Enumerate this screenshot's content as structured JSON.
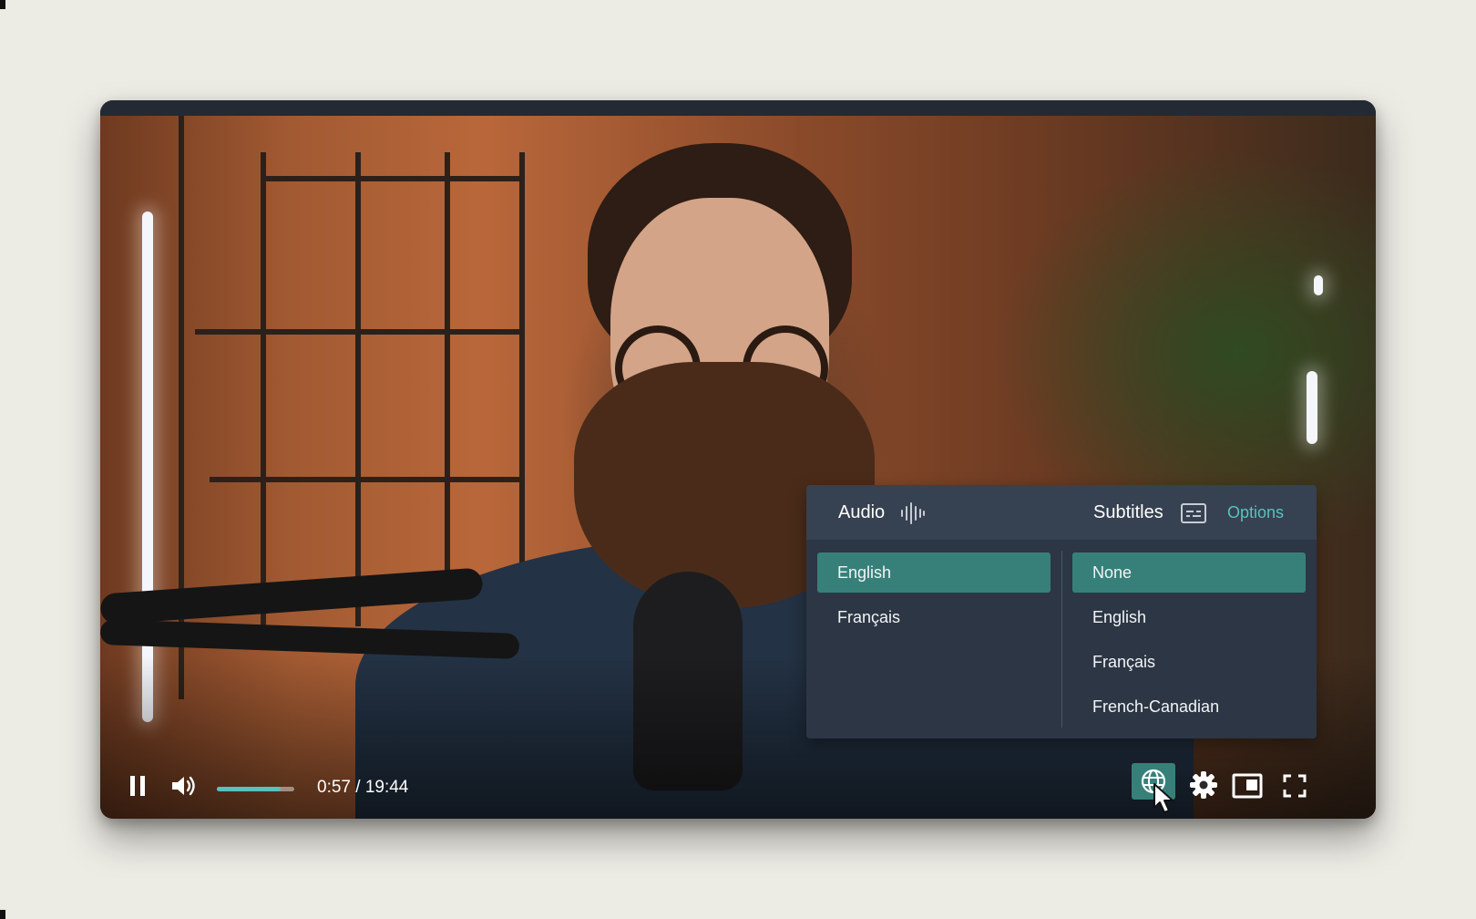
{
  "player": {
    "time": {
      "current": "0:57",
      "duration": "19:44",
      "display": "0:57 / 19:44"
    },
    "progress_fraction": 0.82,
    "language_panel": {
      "audio_label": "Audio",
      "subtitles_label": "Subtitles",
      "options_label": "Options",
      "audio_options": [
        "English",
        "Français"
      ],
      "audio_selected": "English",
      "subtitle_options": [
        "None",
        "English",
        "Français",
        "French-Canadian"
      ],
      "subtitle_selected": "None"
    },
    "colors": {
      "accent": "#37807a",
      "link": "#56c3bd",
      "panel": "#2c3644",
      "header": "#364151"
    },
    "icons": [
      "pause-icon",
      "volume-icon",
      "globe-icon",
      "gear-icon",
      "picture-in-picture-icon",
      "fullscreen-icon",
      "audio-wave-icon",
      "subtitles-icon",
      "cursor-icon"
    ]
  }
}
